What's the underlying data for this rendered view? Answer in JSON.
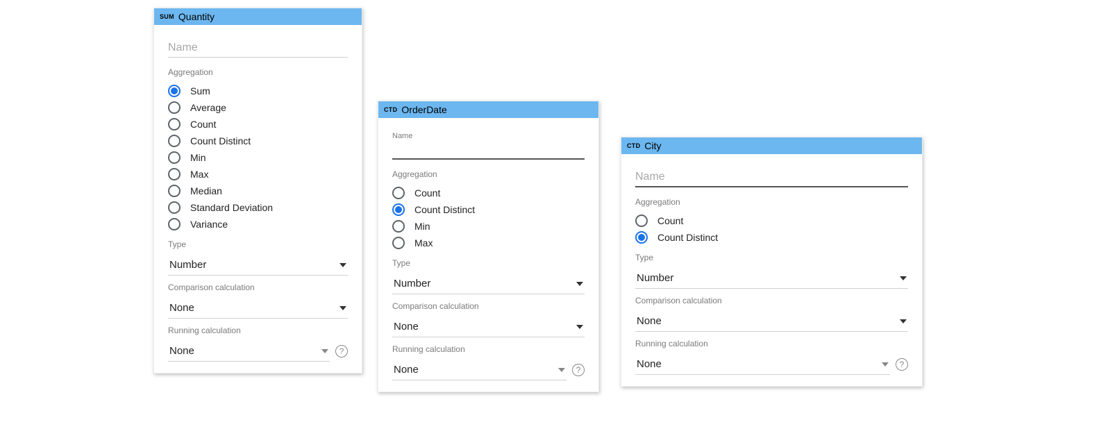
{
  "panels": {
    "quantity": {
      "badge": "SUM",
      "title": "Quantity",
      "name_placeholder": "Name",
      "show_name_as_placeholder": true,
      "focused": false,
      "aggregation_label": "Aggregation",
      "aggregation_options": [
        "Sum",
        "Average",
        "Count",
        "Count Distinct",
        "Min",
        "Max",
        "Median",
        "Standard Deviation",
        "Variance"
      ],
      "aggregation_selected": "Sum",
      "type_label": "Type",
      "type_value": "Number",
      "comparison_label": "Comparison calculation",
      "comparison_value": "None",
      "running_label": "Running calculation",
      "running_value": "None"
    },
    "orderdate": {
      "badge": "CTD",
      "title": "OrderDate",
      "name_label": "Name",
      "name_value": "",
      "focused": true,
      "aggregation_label": "Aggregation",
      "aggregation_options": [
        "Count",
        "Count Distinct",
        "Min",
        "Max"
      ],
      "aggregation_selected": "Count Distinct",
      "type_label": "Type",
      "type_value": "Number",
      "comparison_label": "Comparison calculation",
      "comparison_value": "None",
      "running_label": "Running calculation",
      "running_value": "None"
    },
    "city": {
      "badge": "CTD",
      "title": "City",
      "name_placeholder": "Name",
      "show_name_as_placeholder": true,
      "focused": true,
      "aggregation_label": "Aggregation",
      "aggregation_options": [
        "Count",
        "Count Distinct"
      ],
      "aggregation_selected": "Count Distinct",
      "type_label": "Type",
      "type_value": "Number",
      "comparison_label": "Comparison calculation",
      "comparison_value": "None",
      "running_label": "Running calculation",
      "running_value": "None"
    }
  }
}
